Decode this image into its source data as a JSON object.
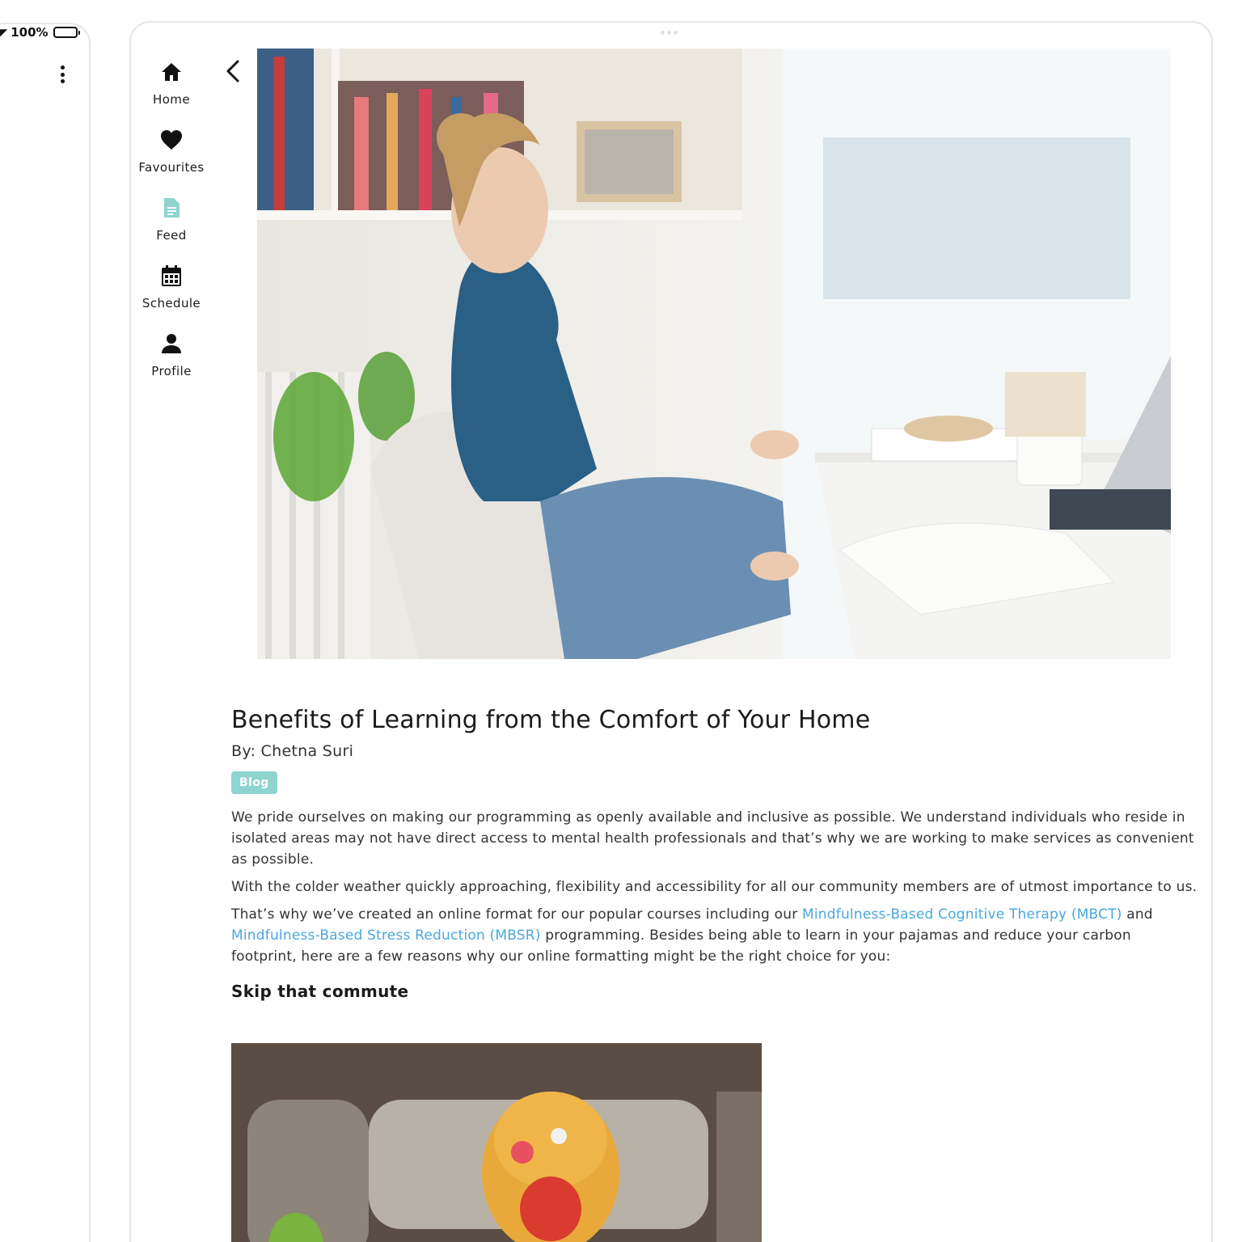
{
  "status_bar": {
    "battery_text": "100%"
  },
  "nav": {
    "items": [
      {
        "label": "Home",
        "icon": "home-icon"
      },
      {
        "label": "Favourites",
        "icon": "heart-icon"
      },
      {
        "label": "Feed",
        "icon": "document-icon",
        "active": true
      },
      {
        "label": "Schedule",
        "icon": "calendar-icon"
      },
      {
        "label": "Profile",
        "icon": "person-icon"
      }
    ],
    "active_color": "#8ed4cf"
  },
  "article": {
    "title": "Benefits of Learning from the Comfort of Your Home",
    "byline": "By: Chetna Suri",
    "tag": "Blog",
    "paragraph_1": "We pride ourselves on making our programming as openly available and inclusive as possible. We understand individuals who reside in isolated areas may not have direct access to mental health professionals and that’s why we are working to make services as convenient as possible.",
    "paragraph_2": "With the colder weather quickly approaching, flexibility and accessibility for all our community members are of utmost importance to us.",
    "paragraph_3": {
      "before": "That’s why we’ve created an online format for our popular courses including our ",
      "link_1": "Mindfulness-Based Cognitive Therapy (MBCT)",
      "between": " and ",
      "link_2": "Mindfulness-Based Stress Reduction (MBSR)",
      "after": " programming. Besides being able to learn in your pajamas and reduce your carbon footprint, here are a few reasons why our online formatting might be the right choice for you:"
    },
    "subheading": "Skip that commute"
  },
  "colors": {
    "link": "#4aa7df",
    "tag_bg": "#8ed4cf"
  }
}
